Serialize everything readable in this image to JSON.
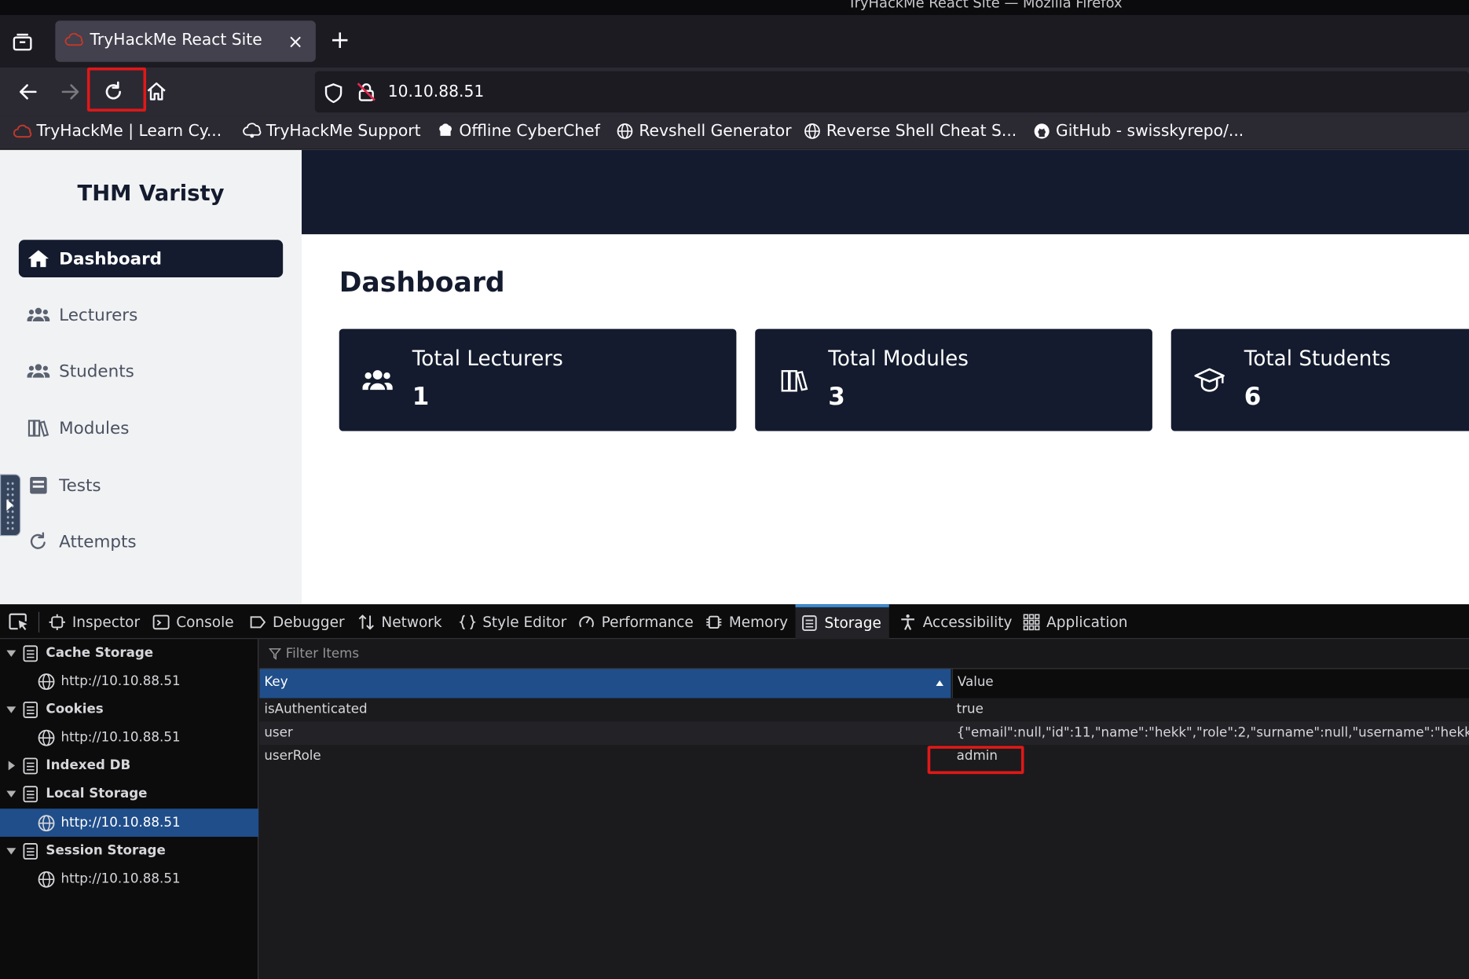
{
  "window": {
    "title": "TryHackMe React Site — Mozilla Firefox"
  },
  "tab": {
    "label": "TryHackMe React Site",
    "close": "×",
    "new_tab": "+"
  },
  "url": "10.10.88.51",
  "bookmarks": [
    {
      "label": "TryHackMe | Learn Cy...",
      "icon": "thm-icon"
    },
    {
      "label": "TryHackMe Support",
      "icon": "support-icon"
    },
    {
      "label": "Offline CyberChef",
      "icon": "chef-icon"
    },
    {
      "label": "Revshell Generator",
      "icon": "globe-icon"
    },
    {
      "label": "Reverse Shell Cheat S...",
      "icon": "globe-icon"
    },
    {
      "label": "GitHub - swisskyrepo/...",
      "icon": "github-icon"
    }
  ],
  "app": {
    "brand": "THM Varisty",
    "nav": [
      {
        "label": "Dashboard",
        "icon": "home-icon",
        "active": true
      },
      {
        "label": "Lecturers",
        "icon": "users-icon",
        "active": false
      },
      {
        "label": "Students",
        "icon": "users-icon",
        "active": false
      },
      {
        "label": "Modules",
        "icon": "books-icon",
        "active": false
      },
      {
        "label": "Tests",
        "icon": "tests-icon",
        "active": false
      },
      {
        "label": "Attempts",
        "icon": "refresh-icon",
        "active": false
      }
    ],
    "page_title": "Dashboard",
    "cards": [
      {
        "title": "Total Lecturers",
        "value": "1",
        "icon": "users-icon"
      },
      {
        "title": "Total Modules",
        "value": "3",
        "icon": "books-icon"
      },
      {
        "title": "Total Students",
        "value": "6",
        "icon": "graduation-cap-icon"
      }
    ]
  },
  "devtools": {
    "tabs": [
      {
        "label": "Inspector",
        "icon": "inspector-icon"
      },
      {
        "label": "Console",
        "icon": "console-icon"
      },
      {
        "label": "Debugger",
        "icon": "debugger-icon"
      },
      {
        "label": "Network",
        "icon": "network-icon"
      },
      {
        "label": "Style Editor",
        "icon": "style-editor-icon"
      },
      {
        "label": "Performance",
        "icon": "performance-icon"
      },
      {
        "label": "Memory",
        "icon": "memory-icon"
      },
      {
        "label": "Storage",
        "icon": "storage-icon",
        "selected": true
      },
      {
        "label": "Accessibility",
        "icon": "accessibility-icon"
      },
      {
        "label": "Application",
        "icon": "application-icon"
      }
    ],
    "tree": [
      {
        "label": "Cache Storage",
        "type": "category",
        "expanded": true
      },
      {
        "label": "http://10.10.88.51",
        "type": "origin"
      },
      {
        "label": "Cookies",
        "type": "category",
        "expanded": true
      },
      {
        "label": "http://10.10.88.51",
        "type": "origin"
      },
      {
        "label": "Indexed DB",
        "type": "category",
        "expanded": false
      },
      {
        "label": "Local Storage",
        "type": "category",
        "expanded": true
      },
      {
        "label": "http://10.10.88.51",
        "type": "origin",
        "selected": true
      },
      {
        "label": "Session Storage",
        "type": "category",
        "expanded": true
      },
      {
        "label": "http://10.10.88.51",
        "type": "origin"
      }
    ],
    "filter_placeholder": "Filter Items",
    "table": {
      "columns": [
        "Key",
        "Value"
      ],
      "rows": [
        {
          "key": "isAuthenticated",
          "value": "true"
        },
        {
          "key": "user",
          "value": "{\"email\":null,\"id\":11,\"name\":\"hekk\",\"role\":2,\"surname\":null,\"username\":\"hekk\"}"
        },
        {
          "key": "userRole",
          "value": "admin"
        }
      ]
    }
  },
  "colors": {
    "highlight": "#e01818",
    "app_dark": "#141b2e",
    "devtools_selection": "#204e8a"
  }
}
